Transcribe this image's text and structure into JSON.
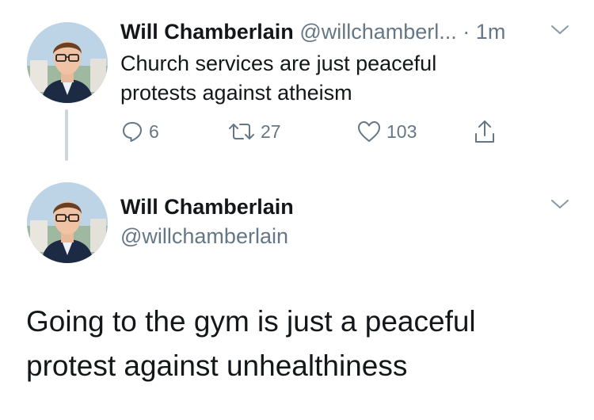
{
  "tweet1": {
    "name": "Will Chamberlain",
    "handle": "@willchamberl...",
    "separator": "·",
    "time": "1m",
    "text": "Church services are just peaceful protests against atheism",
    "reply_count": "6",
    "retweet_count": "27",
    "like_count": "103",
    "icons": {
      "reply": "reply-icon",
      "retweet": "retweet-icon",
      "like": "heart-icon",
      "share": "share-icon",
      "menu": "chevron-down-icon"
    }
  },
  "tweet2": {
    "name": "Will Chamberlain",
    "handle": "@willchamberlain",
    "text": "Going to the gym is just a peaceful protest against unhealthiness"
  },
  "colors": {
    "text": "#14171a",
    "secondary": "#657786",
    "thread_line": "#ccd6dd"
  }
}
